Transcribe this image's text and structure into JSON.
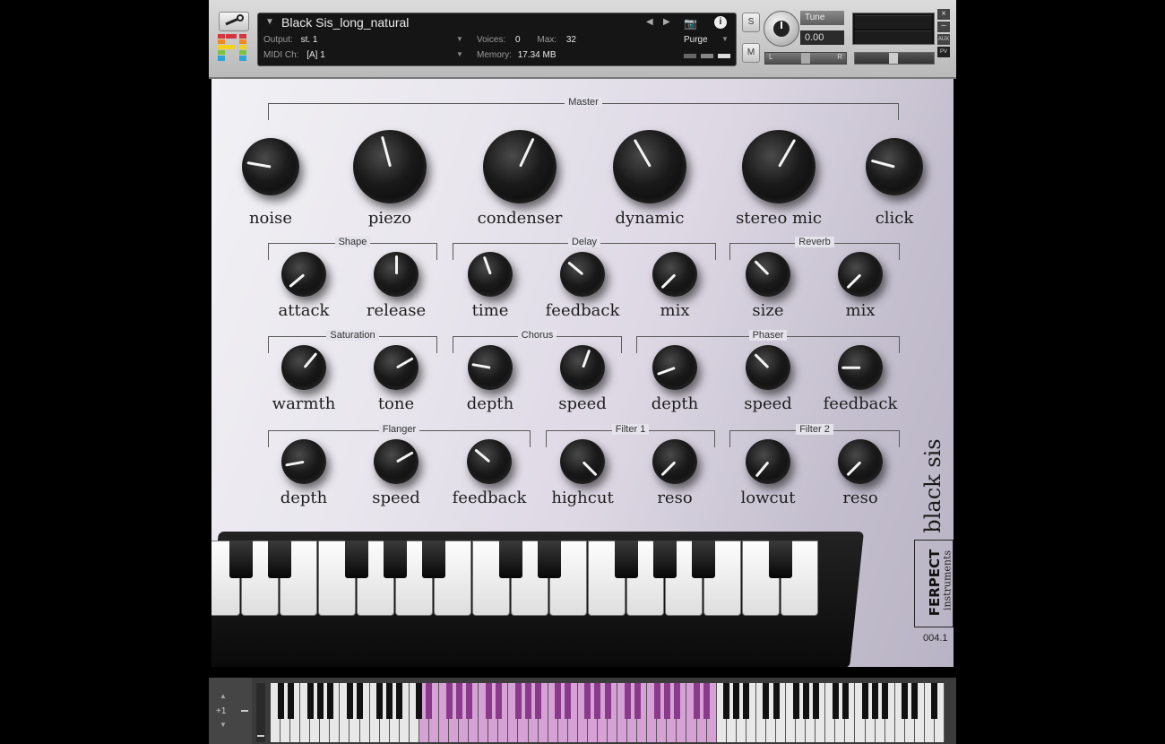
{
  "header": {
    "instrument_name": "Black Sis_long_natural",
    "output_label": "Output:",
    "output_value": "st. 1",
    "midi_label": "MIDI Ch:",
    "midi_value": "[A]  1",
    "voices_label": "Voices:",
    "voices_value": "0",
    "max_label": "Max:",
    "max_value": "32",
    "memory_label": "Memory:",
    "memory_value": "17.34 MB",
    "purge_label": "Purge",
    "solo_label": "S",
    "mute_label": "M",
    "tune_label": "Tune",
    "tune_value": "0.00",
    "aux_label": "AUX",
    "pv_label": "PV",
    "pan_left": "L",
    "pan_right": "R"
  },
  "panel": {
    "master_title": "Master",
    "master_knobs": [
      {
        "label": "noise",
        "angle": -80
      },
      {
        "label": "piezo",
        "angle": -15
      },
      {
        "label": "condenser",
        "angle": 25
      },
      {
        "label": "dynamic",
        "angle": -30
      },
      {
        "label": "stereo mic",
        "angle": 30
      },
      {
        "label": "click",
        "angle": -75
      }
    ],
    "groups": [
      {
        "title": "Shape",
        "knobs": [
          {
            "label": "attack",
            "angle": -130
          },
          {
            "label": "release",
            "angle": 0
          }
        ]
      },
      {
        "title": "Delay",
        "knobs": [
          {
            "label": "time",
            "angle": -20
          },
          {
            "label": "feedback",
            "angle": -50
          },
          {
            "label": "mix",
            "angle": -135
          }
        ]
      },
      {
        "title": "Reverb",
        "knobs": [
          {
            "label": "size",
            "angle": -45
          },
          {
            "label": "mix",
            "angle": -135
          }
        ]
      },
      {
        "title": "Saturation",
        "knobs": [
          {
            "label": "warmth",
            "angle": 40
          },
          {
            "label": "tone",
            "angle": 60
          }
        ]
      },
      {
        "title": "Chorus",
        "knobs": [
          {
            "label": "depth",
            "angle": -80
          },
          {
            "label": "speed",
            "angle": 20
          }
        ]
      },
      {
        "title": "Phaser",
        "knobs": [
          {
            "label": "depth",
            "angle": -110
          },
          {
            "label": "speed",
            "angle": -45
          },
          {
            "label": "feedback",
            "angle": -90
          }
        ]
      },
      {
        "title": "Flanger",
        "knobs": [
          {
            "label": "depth",
            "angle": -100
          },
          {
            "label": "speed",
            "angle": 60
          },
          {
            "label": "feedback",
            "angle": -50
          }
        ]
      },
      {
        "title": "Filter 1",
        "knobs": [
          {
            "label": "highcut",
            "angle": 135
          },
          {
            "label": "reso",
            "angle": -135
          }
        ]
      },
      {
        "title": "Filter 2",
        "knobs": [
          {
            "label": "lowcut",
            "angle": -140
          },
          {
            "label": "reso",
            "angle": -135
          }
        ]
      }
    ],
    "brand_name": "black sis",
    "maker_top": "FERPECT",
    "maker_bottom": "instruments",
    "version": "004.1"
  },
  "keyboard": {
    "octave_label": "+1"
  }
}
